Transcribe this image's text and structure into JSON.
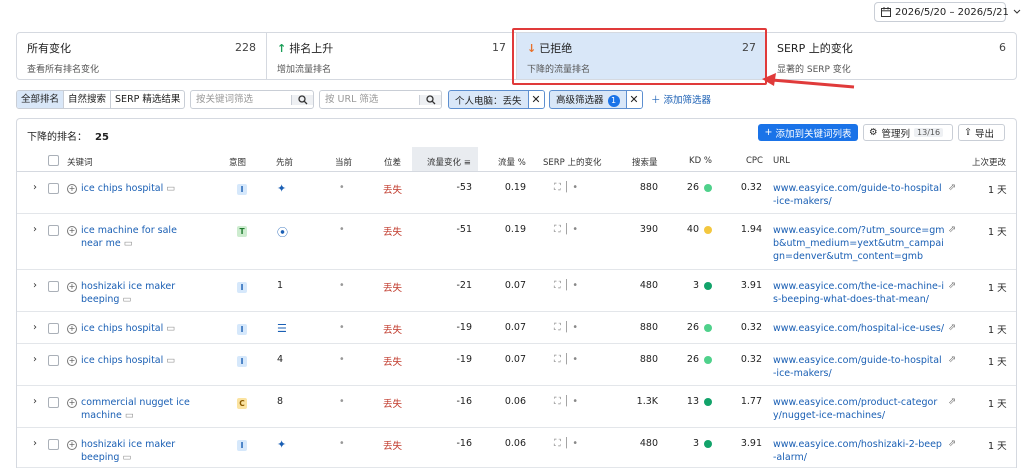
{
  "date_range": "2026/5/20 – 2026/5/21",
  "cards": [
    {
      "title": "所有变化",
      "count": "228",
      "sub": "查看所有排名变化",
      "arrow": ""
    },
    {
      "title": "排名上升",
      "count": "17",
      "sub": "增加流量排名",
      "arrow": "↑"
    },
    {
      "title": "已拒绝",
      "count": "27",
      "sub": "下降的流量排名",
      "arrow": "↓"
    },
    {
      "title": "SERP 上的变化",
      "count": "6",
      "sub": "显著的 SERP 变化",
      "arrow": ""
    }
  ],
  "filters": {
    "seg": [
      "全部排名",
      "自然搜索",
      "SERP 精选结果"
    ],
    "kw_placeholder": "按关键词筛选",
    "url_placeholder": "按 URL 筛选",
    "chip1": "个人电脑：丢失",
    "chip2": "高级筛选器",
    "chip2_badge": "1",
    "add_filter": "添加筛选器"
  },
  "table_bar": {
    "label": "下降的排名：",
    "count": "25",
    "add_btn": "添加到关键词列表",
    "cols_btn": "管理列",
    "cols_count": "13/16",
    "export_btn": "导出"
  },
  "headers": {
    "kw": "关键词",
    "intent": "意图",
    "prev": "先前",
    "cur": "当前",
    "pos": "位差",
    "traffic": "流量变化",
    "trafpct": "流量 %",
    "serp": "SERP 上的变化",
    "vol": "搜索量",
    "kd": "KD %",
    "cpc": "CPC",
    "url": "URL",
    "updated": "上次更改"
  },
  "rows": [
    {
      "kw": "ice chips hospital",
      "intent": "I",
      "prev": "",
      "cur": "•",
      "pos": "丢失",
      "traffic": "-53",
      "pct": "0.19",
      "serp": "•",
      "vol": "880",
      "kd": "26",
      "kd_color": "#4fd18b",
      "cpc": "0.32",
      "url": "www.easyice.com/guide-to-hospital-ice-makers/",
      "updated": "1 天"
    },
    {
      "kw": "ice machine for sale near me",
      "intent": "T",
      "prev": "",
      "cur": "•",
      "pos": "丢失",
      "traffic": "-51",
      "pct": "0.19",
      "serp": "•",
      "vol": "390",
      "kd": "40",
      "kd_color": "#f3c73f",
      "cpc": "1.94",
      "url": "www.easyice.com/?utm_source=gmb&utm_medium=yext&utm_campaign=denver&utm_content=gmb",
      "updated": "1 天"
    },
    {
      "kw": "hoshizaki ice maker beeping",
      "intent": "I",
      "prev": "1",
      "cur": "•",
      "pos": "丢失",
      "traffic": "-21",
      "pct": "0.07",
      "serp": "•",
      "vol": "480",
      "kd": "3",
      "kd_color": "#12a36a",
      "cpc": "3.91",
      "url": "www.easyice.com/the-ice-machine-is-beeping-what-does-that-mean/",
      "updated": "1 天"
    },
    {
      "kw": "ice chips hospital",
      "intent": "I",
      "prev": "",
      "cur": "•",
      "pos": "丢失",
      "traffic": "-19",
      "pct": "0.07",
      "serp": "•",
      "vol": "880",
      "kd": "26",
      "kd_color": "#4fd18b",
      "cpc": "0.32",
      "url": "www.easyice.com/hospital-ice-uses/",
      "updated": "1 天"
    },
    {
      "kw": "ice chips hospital",
      "intent": "I",
      "prev": "4",
      "cur": "•",
      "pos": "丢失",
      "traffic": "-19",
      "pct": "0.07",
      "serp": "•",
      "vol": "880",
      "kd": "26",
      "kd_color": "#4fd18b",
      "cpc": "0.32",
      "url": "www.easyice.com/guide-to-hospital-ice-makers/",
      "updated": "1 天"
    },
    {
      "kw": "commercial nugget ice machine",
      "intent": "C",
      "prev": "8",
      "cur": "•",
      "pos": "丢失",
      "traffic": "-16",
      "pct": "0.06",
      "serp": "•",
      "vol": "1.3K",
      "kd": "13",
      "kd_color": "#12a36a",
      "cpc": "1.77",
      "url": "www.easyice.com/product-category/nugget-ice-machines/",
      "updated": "1 天"
    },
    {
      "kw": "hoshizaki ice maker beeping",
      "intent": "I",
      "prev": "",
      "cur": "•",
      "pos": "丢失",
      "traffic": "-16",
      "pct": "0.06",
      "serp": "•",
      "vol": "480",
      "kd": "3",
      "kd_color": "#12a36a",
      "cpc": "3.91",
      "url": "www.easyice.com/hoshizaki-2-beep-alarm/",
      "updated": "1 天"
    }
  ]
}
